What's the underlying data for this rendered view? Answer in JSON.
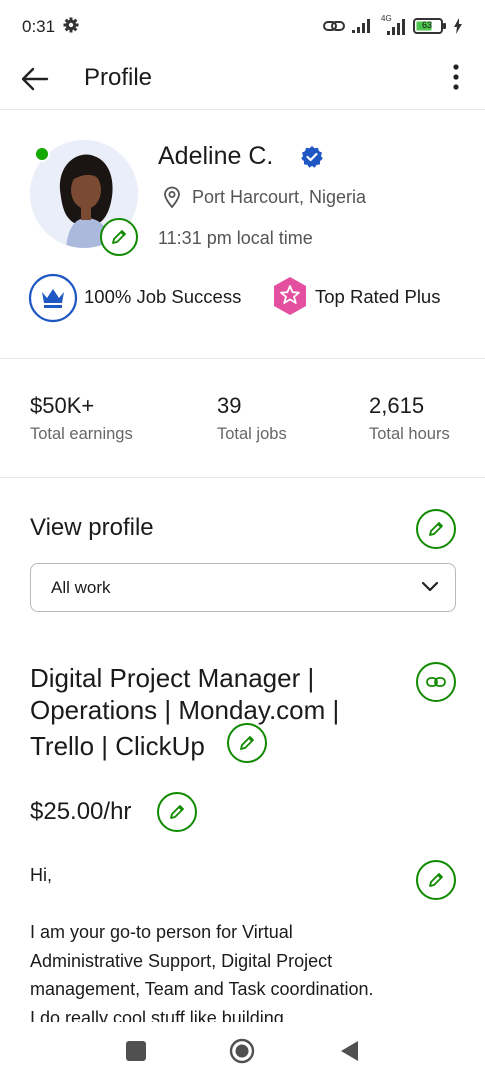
{
  "status_bar": {
    "time": "0:31",
    "network": "4G",
    "battery": "63"
  },
  "app_bar": {
    "title": "Profile"
  },
  "profile": {
    "name": "Adeline C.",
    "location": "Port Harcourt, Nigeria",
    "local_time": "11:31 pm local time",
    "badges": [
      {
        "label": "100% Job Success",
        "icon": "crown-icon"
      },
      {
        "label": "Top Rated Plus",
        "icon": "top-rated-plus-icon"
      }
    ]
  },
  "stats": [
    {
      "value": "$50K+",
      "label": "Total earnings"
    },
    {
      "value": "39",
      "label": "Total jobs"
    },
    {
      "value": "2,615",
      "label": "Total hours"
    }
  ],
  "view_profile": {
    "heading": "View profile",
    "dropdown_value": "All work"
  },
  "listing": {
    "title_lines": [
      "Digital Project Manager |",
      "Operations | Monday.com |",
      "Trello | ClickUp"
    ],
    "rate": "$25.00/hr",
    "greeting": "Hi,",
    "bio_lines": [
      "I am your go-to person for Virtual",
      "Administrative Support, Digital Project",
      "management, Team and Task coordination.",
      "I do really cool stuff like building"
    ]
  },
  "colors": {
    "accent_green": "#108a00",
    "online_green": "#14a800",
    "verified_blue": "#1f57c3",
    "badge_blue": "#1f57c3",
    "badge_pink": "#e44fa0"
  }
}
